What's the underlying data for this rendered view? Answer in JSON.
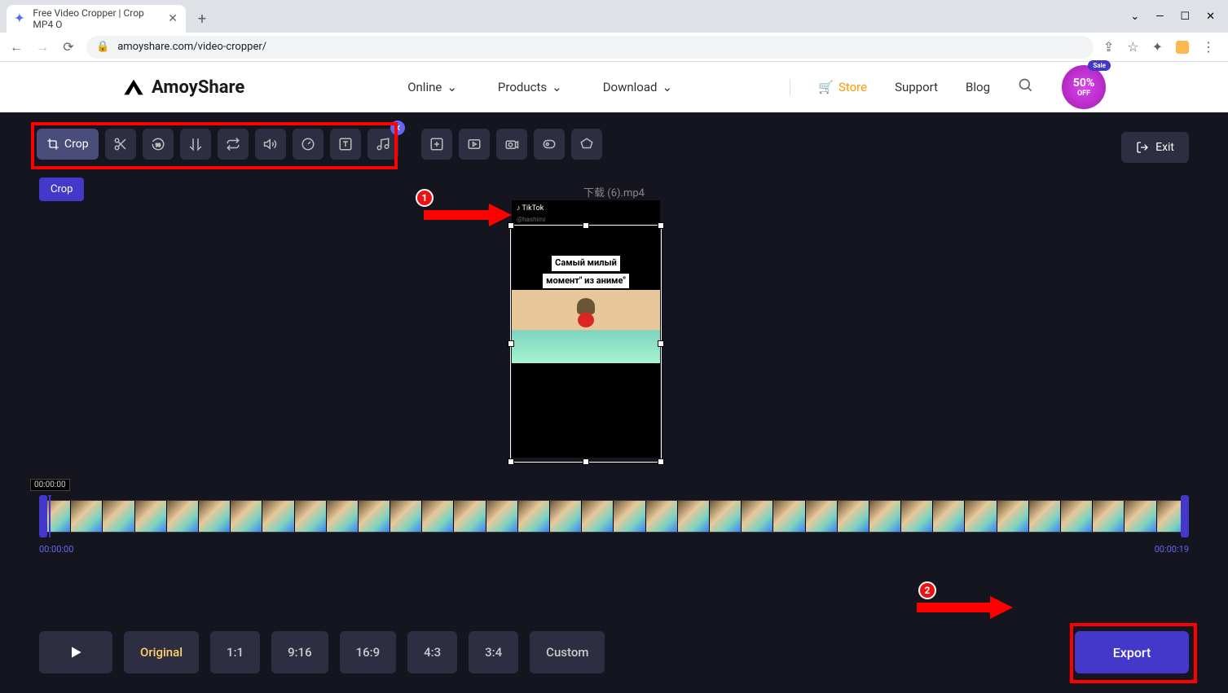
{
  "browser": {
    "tab_title": "Free Video Cropper | Crop MP4 O",
    "url_display": "amoyshare.com/video-cropper/",
    "win": {
      "min": "—",
      "max": "☐",
      "close": "✕",
      "chev": "⌄"
    }
  },
  "header": {
    "brand": "AmoyShare",
    "nav": [
      "Online",
      "Products",
      "Download"
    ],
    "store": "Store",
    "support": "Support",
    "blog": "Blog",
    "badge_sale": "Sale",
    "badge_pct": "50%",
    "badge_off": "OFF"
  },
  "toolbar": {
    "crop": "Crop",
    "exit": "Exit",
    "crop_label": "Crop"
  },
  "preview": {
    "filename": "下载 (6).mp4",
    "watermark": "♪ TikTok",
    "handle": "@hashimi",
    "caption1": "Самый милый",
    "caption2": "момент\" из аниме\""
  },
  "annotations": {
    "a1": "1",
    "a2": "2"
  },
  "timeline": {
    "cursor": "00:00:00",
    "start": "00:00:00",
    "end": "00:00:19"
  },
  "ratios": [
    "Original",
    "1:1",
    "9:16",
    "16:9",
    "4:3",
    "3:4",
    "Custom"
  ],
  "export": "Export"
}
